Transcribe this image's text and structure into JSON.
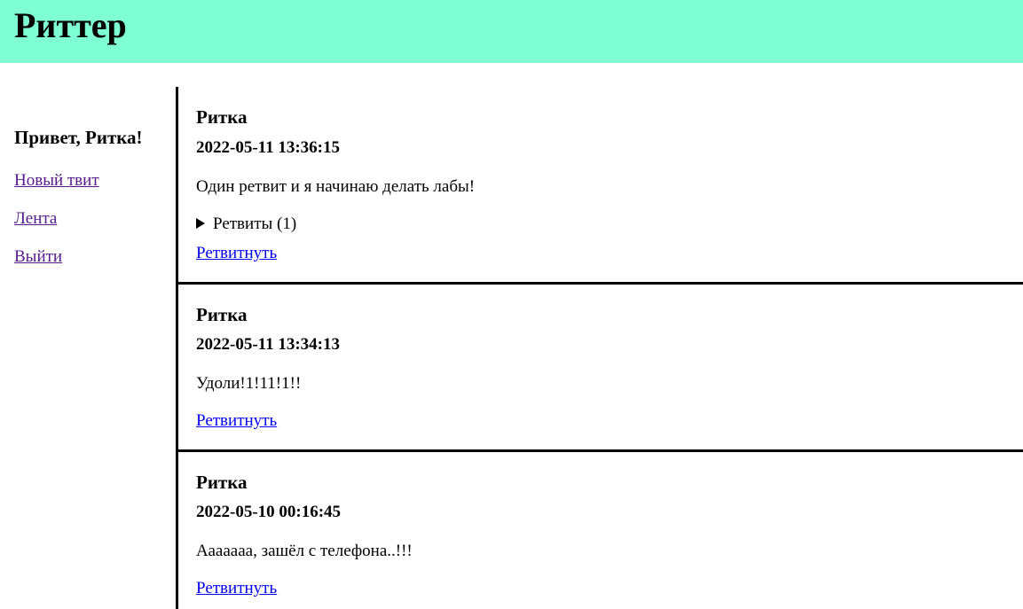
{
  "app": {
    "title": "Риттер"
  },
  "sidebar": {
    "greeting": "Привет, Ритка!",
    "links": [
      {
        "label": "Новый твит"
      },
      {
        "label": "Лента"
      },
      {
        "label": "Выйти"
      }
    ]
  },
  "feed": {
    "tweets": [
      {
        "author": "Ритка",
        "timestamp": "2022-05-11 13:36:15",
        "text": "Один ретвит и я начинаю делать лабы!",
        "retweets_label": "Ретвиты (1)",
        "retweet_button": "Ретвитнуть"
      },
      {
        "author": "Ритка",
        "timestamp": "2022-05-11 13:34:13",
        "text": "Удоли!1!11!1!!",
        "retweet_button": "Ретвитнуть"
      },
      {
        "author": "Ритка",
        "timestamp": "2022-05-10 00:16:45",
        "text": "Ааааааа, зашёл с телефона..!!!",
        "retweet_button": "Ретвитнуть"
      }
    ]
  },
  "colors": {
    "header_bg": "#7fffd4",
    "visited_link": "#551a8b",
    "link": "#0000ee"
  }
}
